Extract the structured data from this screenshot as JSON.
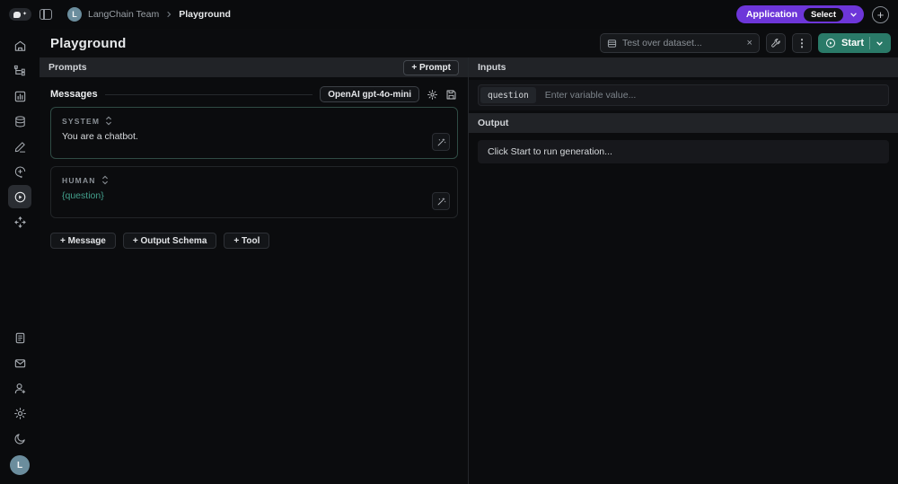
{
  "topbar": {
    "breadcrumb": {
      "team": "LangChain Team",
      "page": "Playground",
      "avatar_initial": "L"
    },
    "application_label": "Application",
    "select_label": "Select"
  },
  "icons": {
    "clear": "×",
    "kebab": "⋮",
    "plus": "+",
    "logo_star": "✦",
    "sidebar_top": [
      "home",
      "trace-graph",
      "monitor-chart",
      "datasets-database",
      "annotate-pencil",
      "chat-add",
      "playground-play",
      "deploy-arrows"
    ],
    "sidebar_bottom": [
      "docs-file",
      "mail",
      "invite-user",
      "settings-gear",
      "dark-mode-moon"
    ]
  },
  "header": {
    "title": "Playground",
    "dataset_placeholder": "Test over dataset...",
    "start_label": "Start"
  },
  "prompts_panel": {
    "title": "Prompts",
    "add_prompt_label": "+ Prompt",
    "messages": {
      "title": "Messages",
      "model_chip": "OpenAI gpt-4o-mini",
      "items": [
        {
          "role": "SYSTEM",
          "content": "You are a chatbot."
        },
        {
          "role": "HUMAN",
          "content": "{question}"
        }
      ],
      "actions": {
        "message": "+ Message",
        "output_schema": "+ Output Schema",
        "tool": "+ Tool"
      }
    }
  },
  "io_panel": {
    "inputs_title": "Inputs",
    "variable_name": "question",
    "variable_placeholder": "Enter variable value...",
    "output_title": "Output",
    "output_placeholder": "Click Start to run generation..."
  },
  "sidebar": {
    "avatar_initial": "L"
  },
  "colors": {
    "start_green": "#2a7a68",
    "application_purple": "#6d36d9",
    "variable_teal": "#43a08c",
    "system_border_teal": "#2f4b44"
  }
}
